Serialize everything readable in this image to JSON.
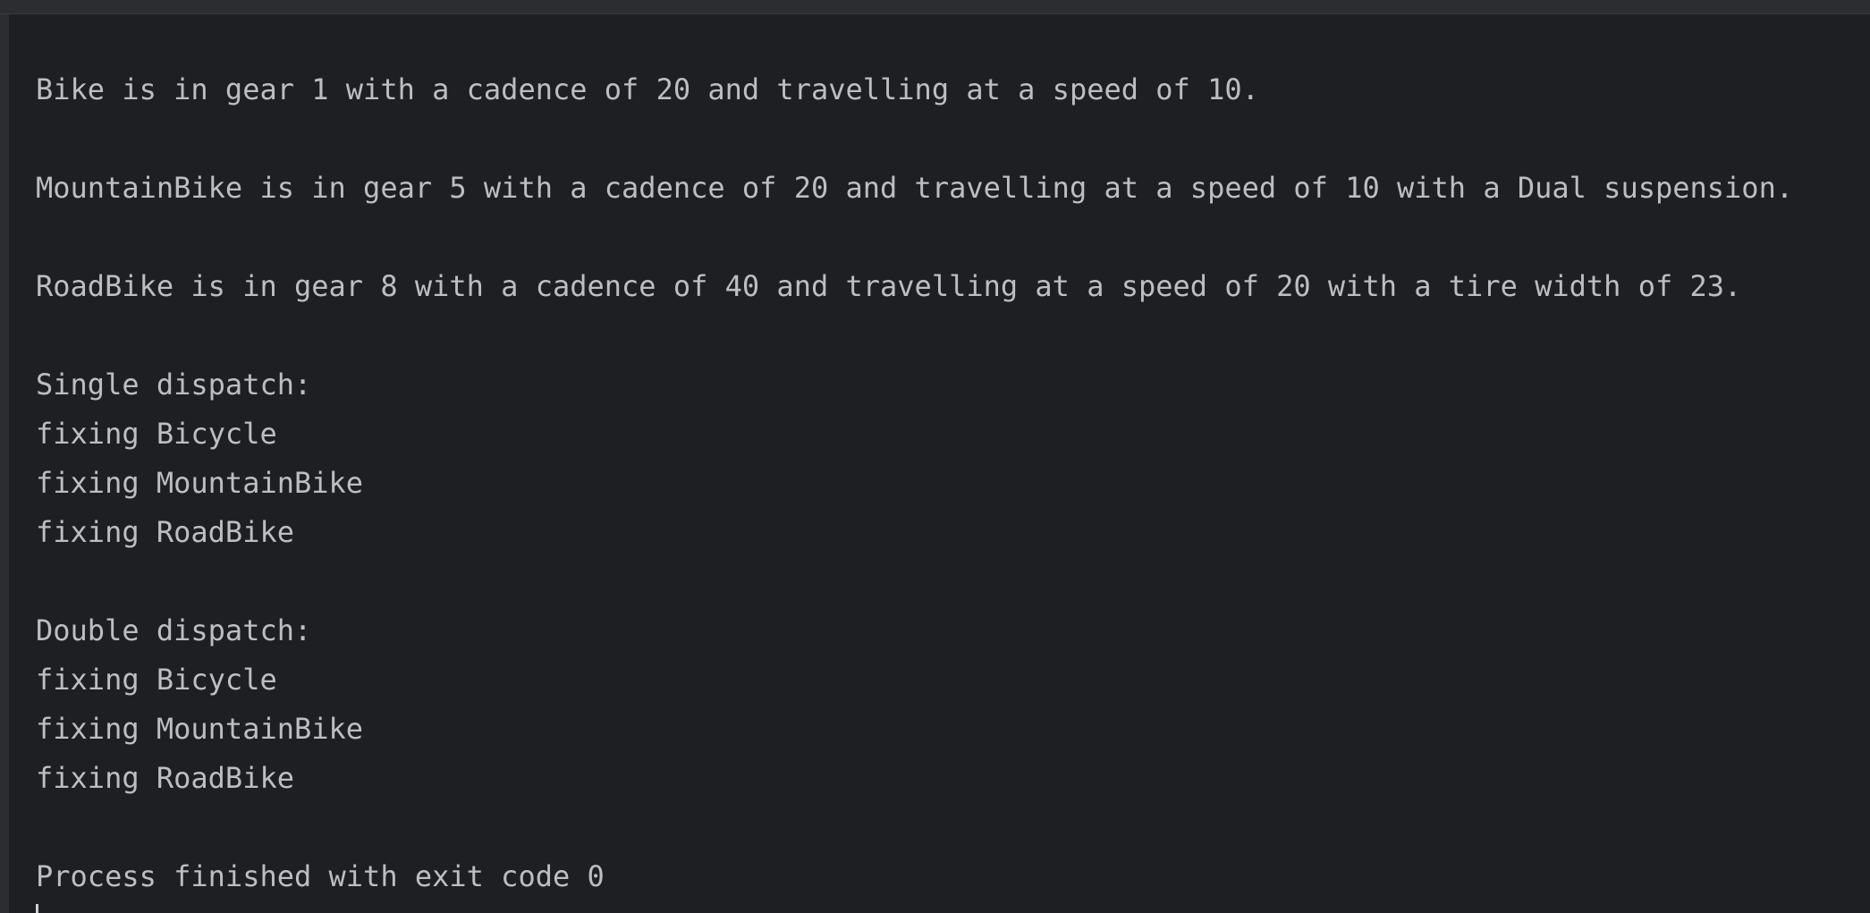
{
  "console": {
    "lines": [
      "Bike is in gear 1 with a cadence of 20 and travelling at a speed of 10.",
      "MountainBike is in gear 5 with a cadence of 20 and travelling at a speed of 10 with a Dual suspension.",
      "RoadBike is in gear 8 with a cadence of 40 and travelling at a speed of 20 with a tire width of 23.",
      "Single dispatch:",
      "fixing Bicycle",
      "fixing MountainBike",
      "fixing RoadBike",
      "Double dispatch:",
      "fixing Bicycle",
      "fixing MountainBike",
      "fixing RoadBike",
      "Process finished with exit code 0"
    ]
  },
  "colors": {
    "background": "#1e1f22",
    "text": "#bcbec4",
    "top_bar": "#2b2d30"
  }
}
